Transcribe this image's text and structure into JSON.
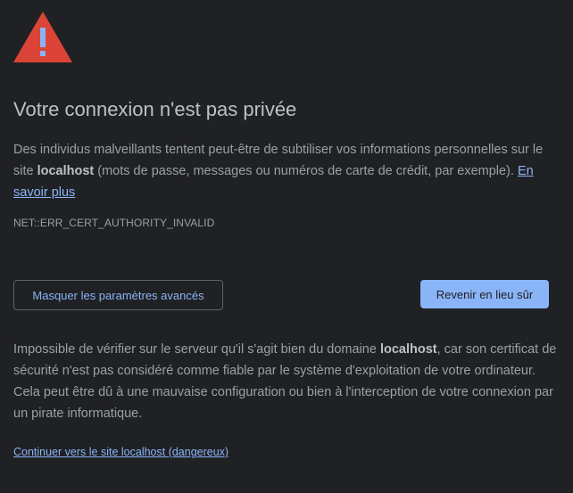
{
  "icon": {
    "name": "warning-triangle-icon",
    "color": "#db4437",
    "mark_color": "#8ab4f8"
  },
  "page": {
    "title": "Votre connexion n'est pas privée",
    "description": {
      "part1": "Des individus malveillants tentent peut-être de subtiliser vos informations personnelles sur le site ",
      "host": "localhost",
      "part2": " (mots de passe, messages ou numéros de carte de crédit, par exemple). ",
      "learn_more": "En savoir plus"
    },
    "error_code": "NET::ERR_CERT_AUTHORITY_INVALID"
  },
  "buttons": {
    "hide_advanced": "Masquer les paramètres avancés",
    "back_to_safety": "Revenir en lieu sûr"
  },
  "details": {
    "part1": "Impossible de vérifier sur le serveur qu'il s'agit bien du domaine ",
    "host": "localhost",
    "part2": ", car son certificat de sécurité n'est pas considéré comme fiable par le système d'exploitation de votre ordinateur. Cela peut être dû à une mauvaise configuration ou bien à l'interception de votre connexion par un pirate informatique.",
    "proceed_link": "Continuer vers le site localhost (dangereux)"
  },
  "colors": {
    "background": "#202124",
    "accent": "#8ab4f8",
    "text": "#9aa0a6",
    "title": "#bdc1c6"
  }
}
